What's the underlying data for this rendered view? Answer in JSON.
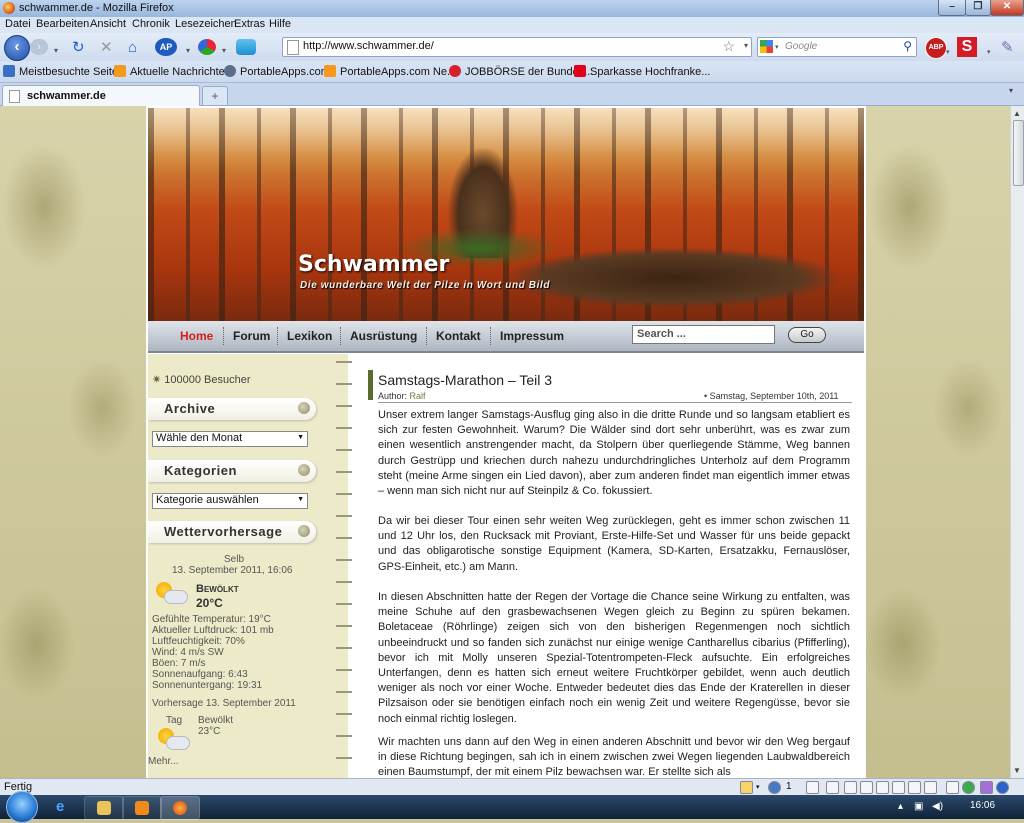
{
  "window": {
    "title": "schwammer.de - Mozilla Firefox"
  },
  "menu": [
    "Datei",
    "Bearbeiten",
    "Ansicht",
    "Chronik",
    "Lesezeichen",
    "Extras",
    "Hilfe"
  ],
  "urlbar": {
    "url": "http://www.schwammer.de/"
  },
  "searchbar": {
    "placeholder": "Google"
  },
  "bookmarks": [
    "Meistbesuchte Seiten",
    "Aktuelle Nachrichten",
    "PortableApps.com",
    "PortableApps.com Ne...",
    "JOBBÖRSE der Bundes...",
    "Sparkasse Hochfranke..."
  ],
  "tab": {
    "label": "schwammer.de",
    "new_tab": "+"
  },
  "site": {
    "title": "Schwammer",
    "subtitle": "Die wunderbare Welt der Pilze in Wort und Bild",
    "nav": [
      "Home",
      "Forum",
      "Lexikon",
      "Ausrüstung",
      "Kontakt",
      "Impressum"
    ],
    "search_placeholder": "Search ...",
    "go": "Go"
  },
  "sidebar": {
    "visitors": "100000 Besucher",
    "archive_title": "Archive",
    "archive_select": "Wähle den Monat",
    "categories_title": "Kategorien",
    "categories_select": "Kategorie auswählen",
    "weather_title": "Wettervorhersage",
    "weather": {
      "location": "Selb",
      "datetime": "13. September 2011, 16:06",
      "condition": "Bewölkt",
      "temp": "20°C",
      "details": [
        "Gefühlte Temperatur: 19°C",
        "Aktueller Luftdruck: 101 mb",
        "Luftfeuchtigkeit: 70%",
        "Wind: 4 m/s SW",
        "Böen: 7 m/s",
        "Sonnenaufgang: 6:43",
        "Sonnenuntergang: 19:31"
      ],
      "forecast_title": "Vorhersage 13. September 2011",
      "forecast_day": "Tag",
      "forecast_condition": "Bewölkt",
      "forecast_temp": "23°C",
      "more": "Mehr..."
    }
  },
  "article": {
    "title": "Samstags-Marathon – Teil 3",
    "author_label": "Author:",
    "author": "Ralf",
    "date": "• Samstag, September 10th, 2011",
    "paragraphs": [
      "Unser extrem langer Samstags-Ausflug ging also in die dritte Runde und so langsam etabliert es sich zur festen Gewohnheit. Warum? Die Wälder sind dort sehr unberührt, was es zwar zum einen wesentlich anstrengender macht, da Stolpern über querliegende Stämme, Weg bannen durch Gestrüpp und kriechen durch nahezu undurchdringliches Unterholz auf dem Programm steht (meine Arme singen ein Lied davon), aber zum anderen findet man eigentlich immer etwas – wenn man sich nicht nur auf Steinpilz & Co. fokussiert.",
      "Da wir bei dieser Tour einen sehr weiten Weg zurücklegen, geht es immer schon zwischen 11 und 12 Uhr los, den Rucksack mit Proviant, Erste-Hilfe-Set und Wasser für uns beide gepackt und das obligarotische sonstige Equipment (Kamera, SD-Karten, Ersatzakku, Fernauslöser, GPS-Einheit, etc.) am Mann.",
      "In diesen Abschnitten hatte der Regen der Vortage die Chance seine Wirkung zu entfalten, was meine Schuhe auf den grasbewachsenen Wegen gleich zu Beginn zu spüren bekamen. Boletaceae (Röhrlinge) zeigen sich von den bisherigen Regenmengen noch sichtlich unbeeindruckt und so fanden sich zunächst nur einige wenige Cantharellus cibarius (Pfifferling), bevor ich mit Molly unseren Spezial-Totentrompeten-Fleck aufsuchte. Ein erfolgreiches Unterfangen, denn es hatten sich erneut weitere Fruchtkörper gebildet, wenn auch deutlich weniger als noch vor einer Woche. Entweder bedeutet dies das Ende der Kraterellen in dieser Pilzsaison oder sie benötigen einfach noch ein wenig Zeit und weitere Regengüsse, bevor sie noch einmal richtig loslegen.",
      "Wir machten uns dann auf den Weg in einen anderen Abschnitt und bevor wir den Weg bergauf in diese Richtung begingen, sah ich in einem zwischen zwei Wegen liegenden Laubwaldbereich einen Baumstumpf, der mit einem Pilz bewachsen war. Er stellte sich als"
    ]
  },
  "status": {
    "text": "Fertig",
    "page_counter": "1"
  },
  "taskbar": {
    "clock": "16:06"
  },
  "colors": {
    "nav_active": "#d81f1f",
    "article_bar": "#5c6b2e",
    "sidebar_bg": "#eceac8"
  }
}
